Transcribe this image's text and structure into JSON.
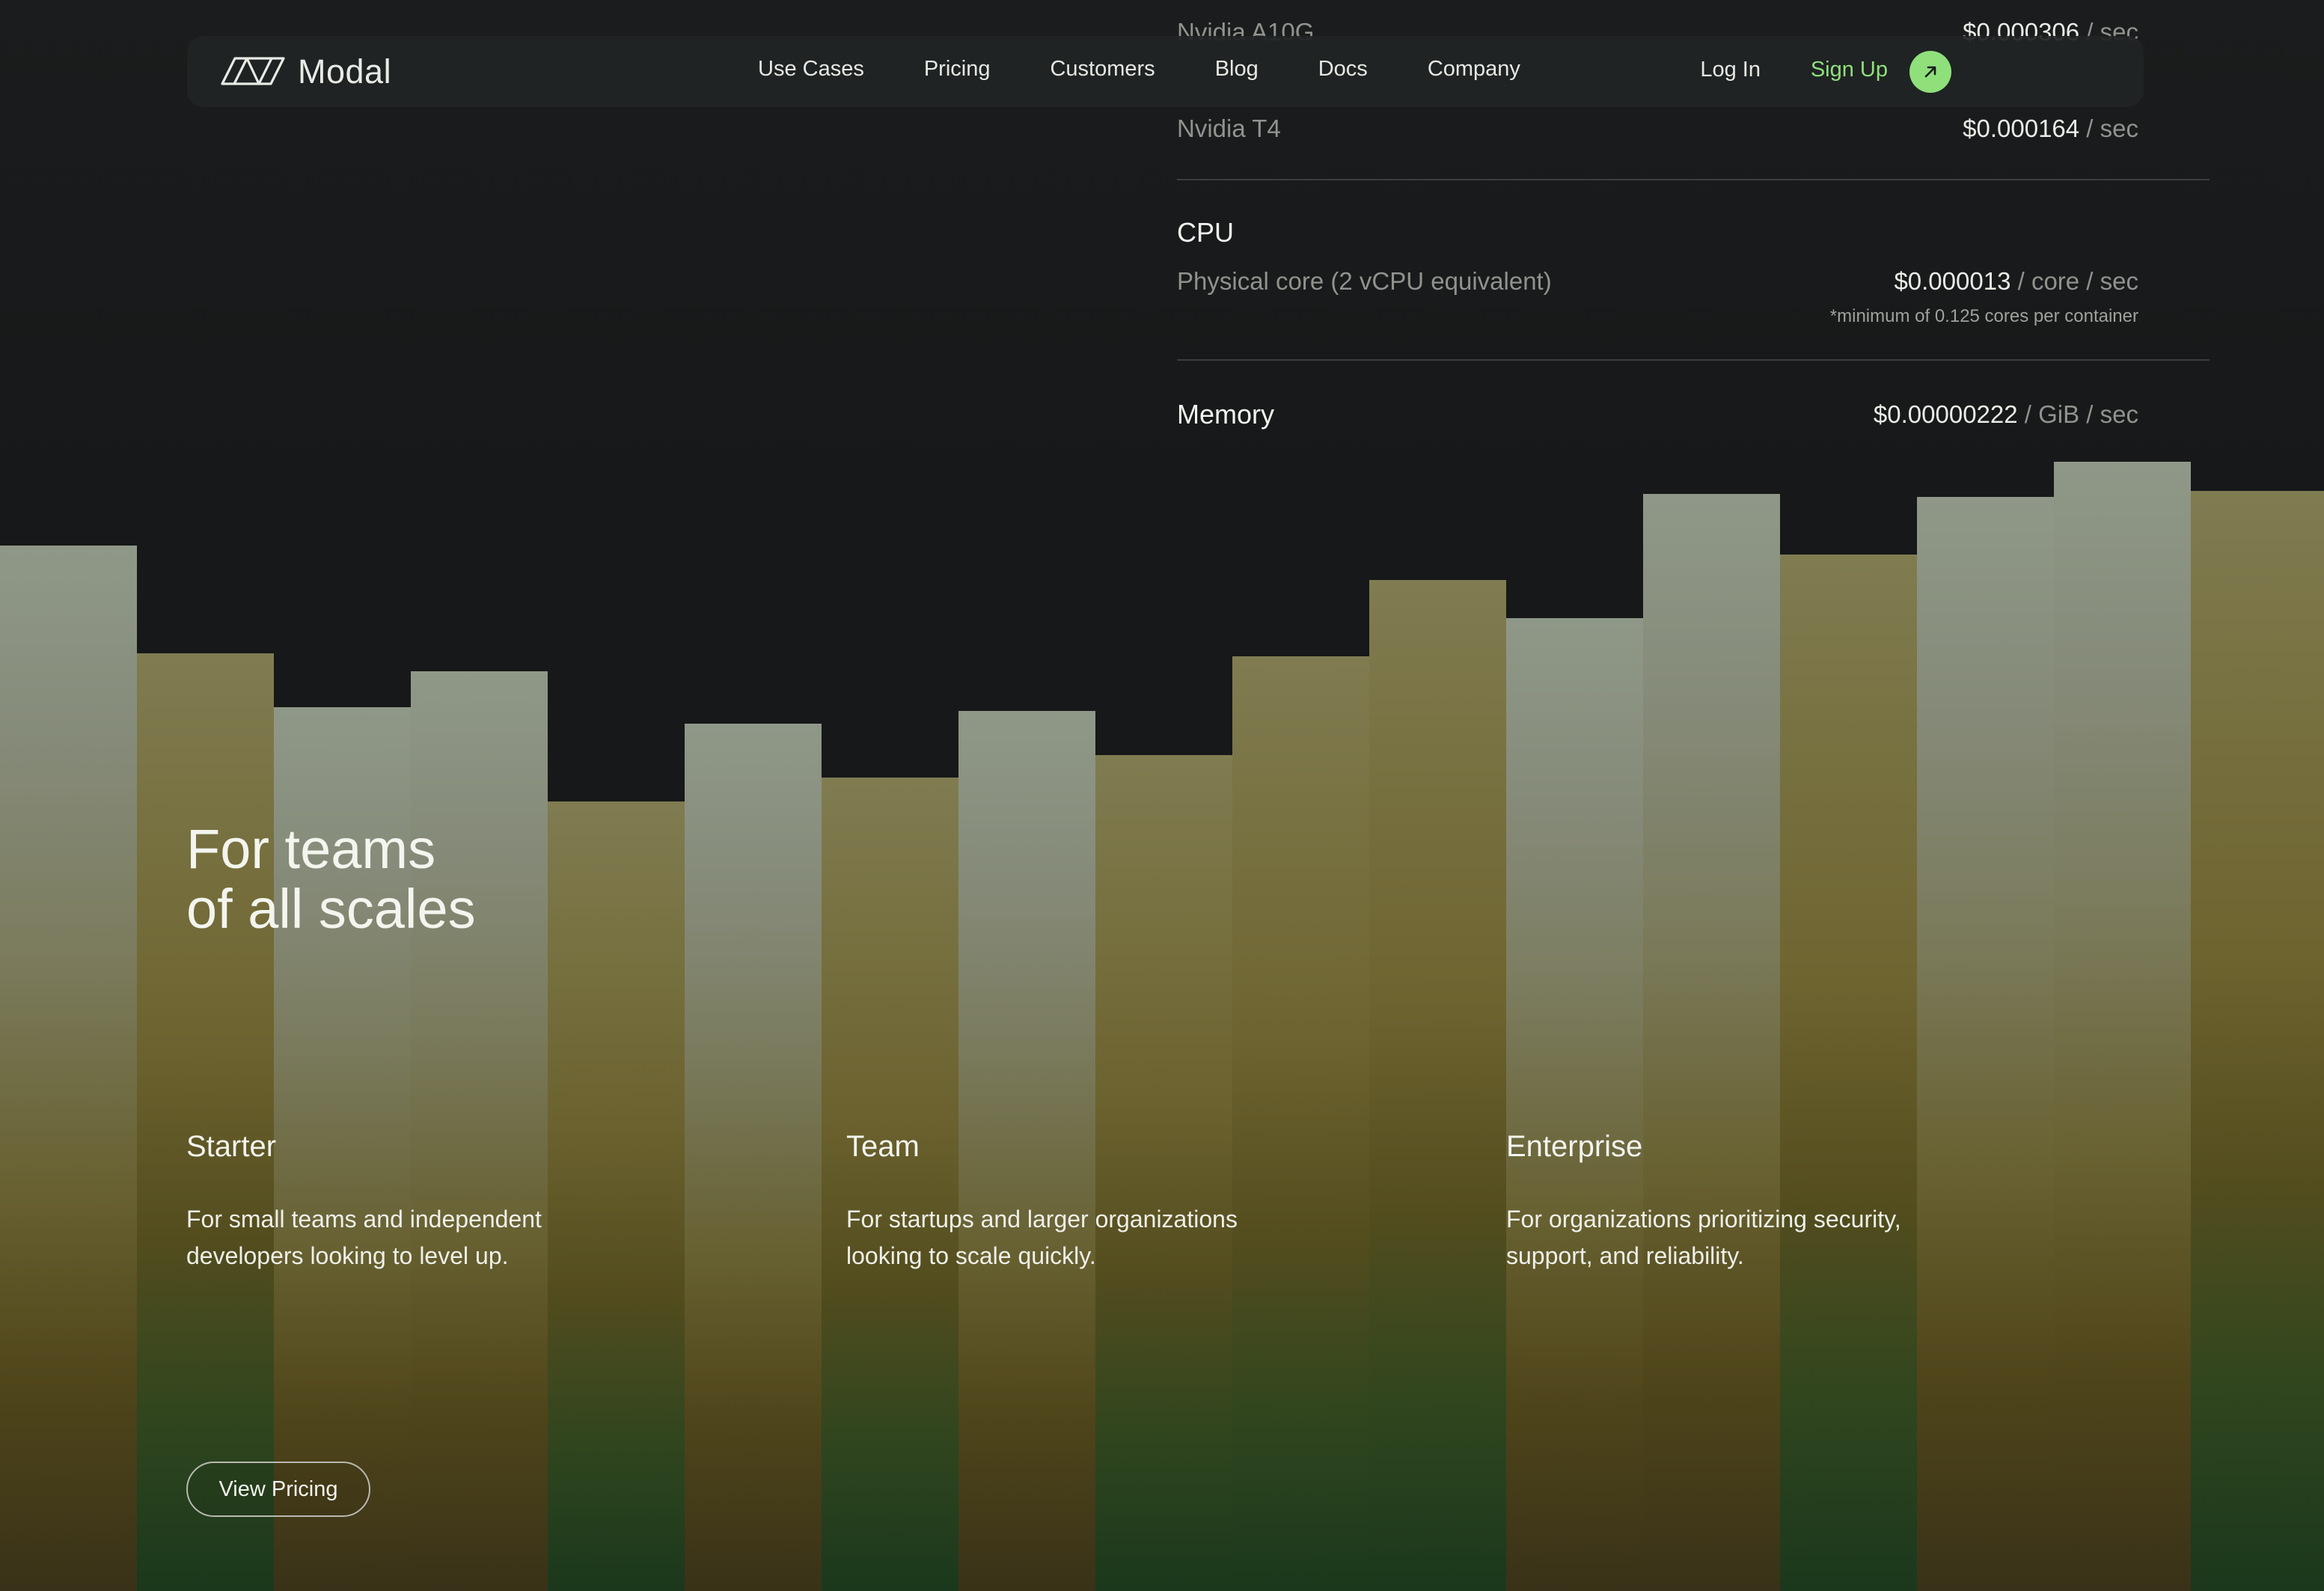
{
  "brand": {
    "name": "Modal",
    "accent": "#8fe07b"
  },
  "nav": {
    "links": [
      "Use Cases",
      "Pricing",
      "Customers",
      "Blog",
      "Docs",
      "Company"
    ],
    "login_label": "Log In",
    "signup_label": "Sign Up",
    "signup_icon": "arrow-up-right-icon"
  },
  "pricing": {
    "gpu_rows": [
      {
        "label": "Nvidia A10G",
        "amount": "$0.000306",
        "unit": " / sec"
      },
      {
        "label": "Nvidia T4",
        "amount": "$0.000164",
        "unit": " / sec"
      }
    ],
    "cpu": {
      "title": "CPU",
      "label": "Physical core (2 vCPU equivalent)",
      "amount": "$0.000013",
      "unit": " / core / sec",
      "footnote": "*minimum of 0.125 cores per container"
    },
    "memory": {
      "title": "Memory",
      "amount": "$0.00000222",
      "unit": " / GiB / sec"
    }
  },
  "hero": {
    "title_line1": "For teams",
    "title_line2": "of all scales"
  },
  "tiers": [
    {
      "name": "Starter",
      "desc_line1": "For small teams and independent",
      "desc_line2": "developers looking to level up."
    },
    {
      "name": "Team",
      "desc_line1": "For startups and larger organizations",
      "desc_line2": "looking to scale quickly."
    },
    {
      "name": "Enterprise",
      "desc_line1": "For organizations prioritizing security,",
      "desc_line2": "support, and reliability."
    }
  ],
  "cta": {
    "view_pricing_label": "View Pricing"
  }
}
